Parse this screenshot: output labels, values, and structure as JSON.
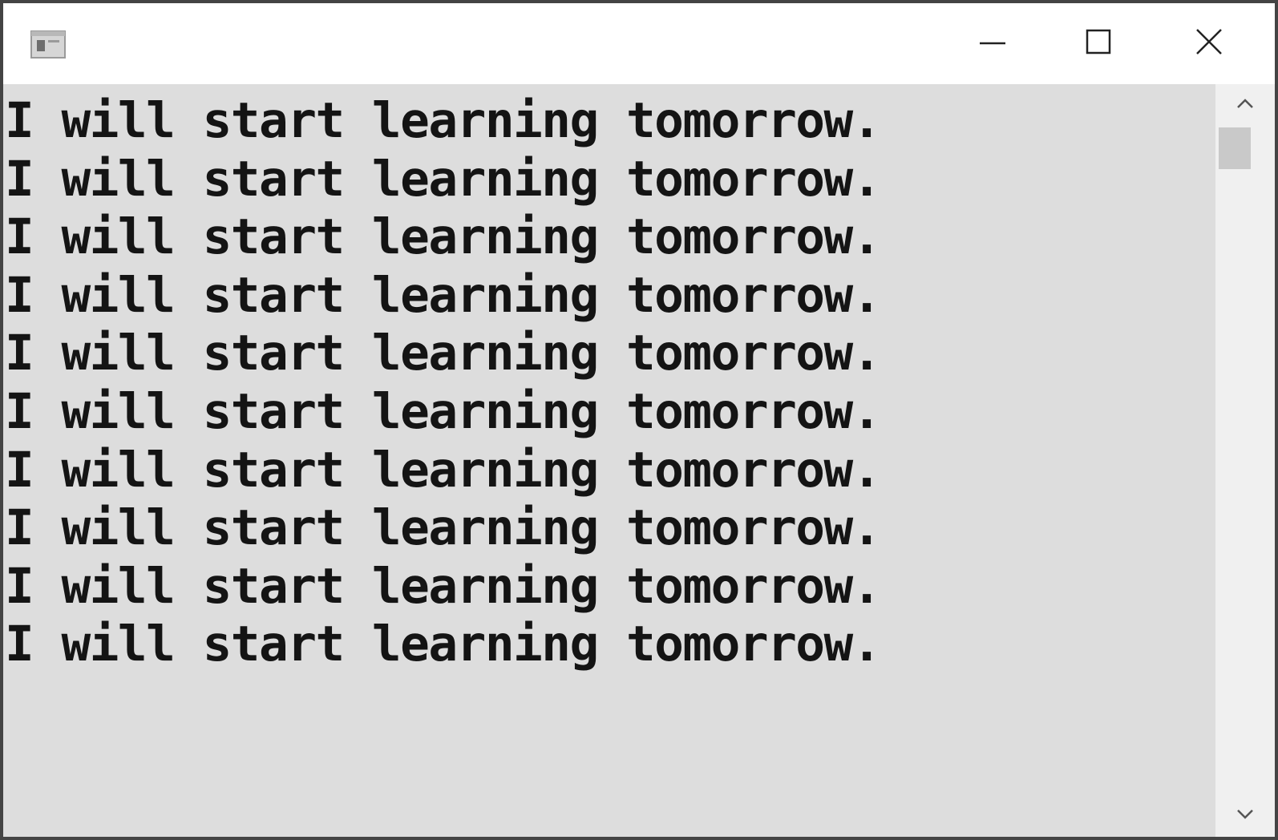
{
  "window": {
    "title": "",
    "icon": "console-app-icon",
    "controls": {
      "minimize": "minimize-icon",
      "maximize": "maximize-icon",
      "close": "close-icon"
    }
  },
  "console": {
    "background": "#dddddd",
    "text_color": "#141414",
    "lines": [
      "I will start learning tomorrow.",
      "I will start learning tomorrow.",
      "I will start learning tomorrow.",
      "I will start learning tomorrow.",
      "I will start learning tomorrow.",
      "I will start learning tomorrow.",
      "I will start learning tomorrow.",
      "I will start learning tomorrow.",
      "I will start learning tomorrow.",
      "I will start learning tomorrow."
    ]
  },
  "scrollbar": {
    "up_icon": "chevron-up-icon",
    "down_icon": "chevron-down-icon"
  }
}
